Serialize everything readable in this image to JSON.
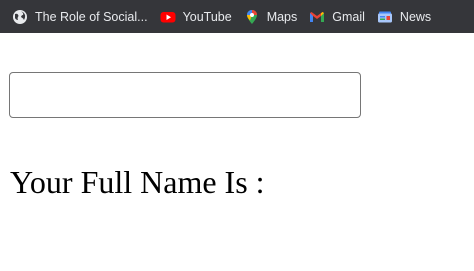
{
  "bookmarks": [
    {
      "label": "The Role of Social...",
      "icon": "globe-icon"
    },
    {
      "label": "YouTube",
      "icon": "youtube-icon"
    },
    {
      "label": "Maps",
      "icon": "maps-pin-icon"
    },
    {
      "label": "Gmail",
      "icon": "gmail-icon"
    },
    {
      "label": "News",
      "icon": "news-icon"
    }
  ],
  "form": {
    "name_value": "",
    "result_label": "Your Full Name Is :"
  },
  "colors": {
    "bookmarks_bar_bg": "#35363a",
    "bookmark_text": "#e8eaed",
    "youtube_red": "#ff0000",
    "page_bg": "#ffffff"
  }
}
